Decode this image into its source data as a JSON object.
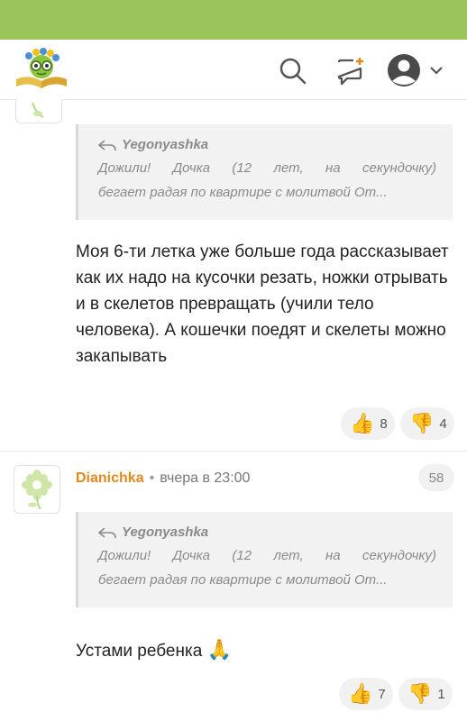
{
  "header": {
    "icons": [
      "logo-icon",
      "search-icon",
      "new-post-icon",
      "user-icon",
      "chevron-down-icon"
    ]
  },
  "comments": [
    {
      "quote": {
        "author": "Yegonyashka",
        "line1": "Дожили! Дочка (12 лет, на секундочку)",
        "line2": "бегает радая по квартире с молитвой От..."
      },
      "text": "Моя 6-ти летка уже больше года рассказывает как их надо на кусочки резать, ножки отрывать и в скелетов превращать (учили тело человека). А кошечки поедят и скелеты можно закапывать",
      "likes": "8",
      "dislikes": "4"
    },
    {
      "author": "Dianichka",
      "time": "вчера в 23:00",
      "number": "58",
      "quote": {
        "author": "Yegonyashka",
        "line1": "Дожили! Дочка (12 лет, на секундочку)",
        "line2": "бегает радая по квартире с молитвой От..."
      },
      "text": "Устами ребенка",
      "emoji": "🙏",
      "likes": "7",
      "dislikes": "1"
    }
  ],
  "colors": {
    "topbar": "#9bc45a",
    "author": "#e08a1e"
  }
}
